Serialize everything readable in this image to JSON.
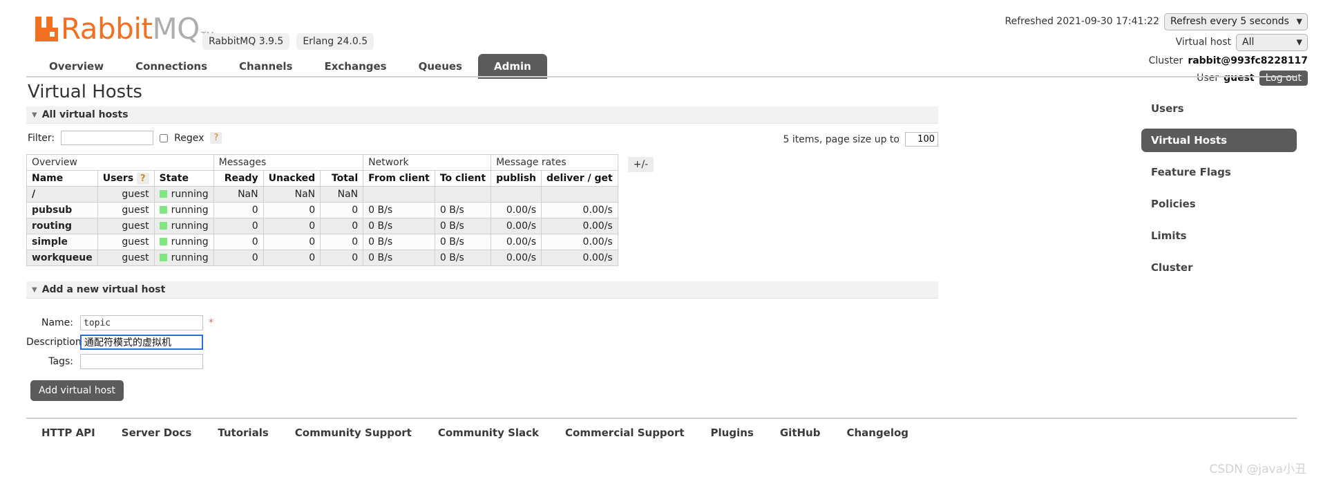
{
  "brand": {
    "name_rabbit": "Rabbit",
    "name_mq": "MQ",
    "tm": "TM",
    "version_badge": "RabbitMQ 3.9.5",
    "erlang_badge": "Erlang 24.0.5",
    "accent_color": "#f36f21",
    "dark_color": "#5b5b5b"
  },
  "status": {
    "refreshed_text": "Refreshed 2021-09-30 17:41:22",
    "refresh_select_value": "Refresh every 5 seconds",
    "vhost_label": "Virtual host",
    "vhost_select_value": "All",
    "cluster_label": "Cluster",
    "cluster_name": "rabbit@993fc8228117",
    "user_label": "User",
    "user_name": "guest",
    "logout_label": "Log out"
  },
  "tabs": [
    {
      "label": "Overview",
      "active": false
    },
    {
      "label": "Connections",
      "active": false
    },
    {
      "label": "Channels",
      "active": false
    },
    {
      "label": "Exchanges",
      "active": false
    },
    {
      "label": "Queues",
      "active": false
    },
    {
      "label": "Admin",
      "active": true
    }
  ],
  "page": {
    "title": "Virtual Hosts",
    "all_vhosts_section": "All virtual hosts",
    "add_vhost_section": "Add a new virtual host"
  },
  "filter": {
    "label": "Filter:",
    "value": "",
    "placeholder": "",
    "regex_label": "Regex",
    "help_glyph": "?",
    "pager_text": "5 items, page size up to",
    "page_size": "100"
  },
  "table": {
    "groups": [
      {
        "label": "Overview",
        "span": 3
      },
      {
        "label": "Messages",
        "span": 3
      },
      {
        "label": "Network",
        "span": 2
      },
      {
        "label": "Message rates",
        "span": 2
      }
    ],
    "columns": [
      {
        "label": "Name",
        "align": "left"
      },
      {
        "label": "Users",
        "align": "right",
        "help": "?"
      },
      {
        "label": "State",
        "align": "left"
      },
      {
        "label": "Ready",
        "align": "right"
      },
      {
        "label": "Unacked",
        "align": "right"
      },
      {
        "label": "Total",
        "align": "right"
      },
      {
        "label": "From client",
        "align": "left"
      },
      {
        "label": "To client",
        "align": "left"
      },
      {
        "label": "publish",
        "align": "right"
      },
      {
        "label": "deliver / get",
        "align": "right"
      }
    ],
    "toggle_columns_label": "+/-",
    "rows": [
      {
        "name": "/",
        "users": "guest",
        "state": "running",
        "ready": "NaN",
        "unacked": "NaN",
        "total": "NaN",
        "from_client": "",
        "to_client": "",
        "publish": "",
        "deliver_get": ""
      },
      {
        "name": "pubsub",
        "users": "guest",
        "state": "running",
        "ready": "0",
        "unacked": "0",
        "total": "0",
        "from_client": "0 B/s",
        "to_client": "0 B/s",
        "publish": "0.00/s",
        "deliver_get": "0.00/s"
      },
      {
        "name": "routing",
        "users": "guest",
        "state": "running",
        "ready": "0",
        "unacked": "0",
        "total": "0",
        "from_client": "0 B/s",
        "to_client": "0 B/s",
        "publish": "0.00/s",
        "deliver_get": "0.00/s"
      },
      {
        "name": "simple",
        "users": "guest",
        "state": "running",
        "ready": "0",
        "unacked": "0",
        "total": "0",
        "from_client": "0 B/s",
        "to_client": "0 B/s",
        "publish": "0.00/s",
        "deliver_get": "0.00/s"
      },
      {
        "name": "workqueue",
        "users": "guest",
        "state": "running",
        "ready": "0",
        "unacked": "0",
        "total": "0",
        "from_client": "0 B/s",
        "to_client": "0 B/s",
        "publish": "0.00/s",
        "deliver_get": "0.00/s"
      }
    ]
  },
  "form": {
    "name_label": "Name:",
    "name_value": "topic",
    "required_mark": "*",
    "description_label": "Description:",
    "description_value": "通配符模式的虚拟机",
    "tags_label": "Tags:",
    "tags_value": "",
    "submit_label": "Add virtual host"
  },
  "sidebar": {
    "items": [
      {
        "label": "Users",
        "active": false
      },
      {
        "label": "Virtual Hosts",
        "active": true
      },
      {
        "label": "Feature Flags",
        "active": false
      },
      {
        "label": "Policies",
        "active": false
      },
      {
        "label": "Limits",
        "active": false
      },
      {
        "label": "Cluster",
        "active": false
      }
    ]
  },
  "footer": {
    "links": [
      "HTTP API",
      "Server Docs",
      "Tutorials",
      "Community Support",
      "Community Slack",
      "Commercial Support",
      "Plugins",
      "GitHub",
      "Changelog"
    ]
  },
  "watermark": "CSDN @java小丑"
}
